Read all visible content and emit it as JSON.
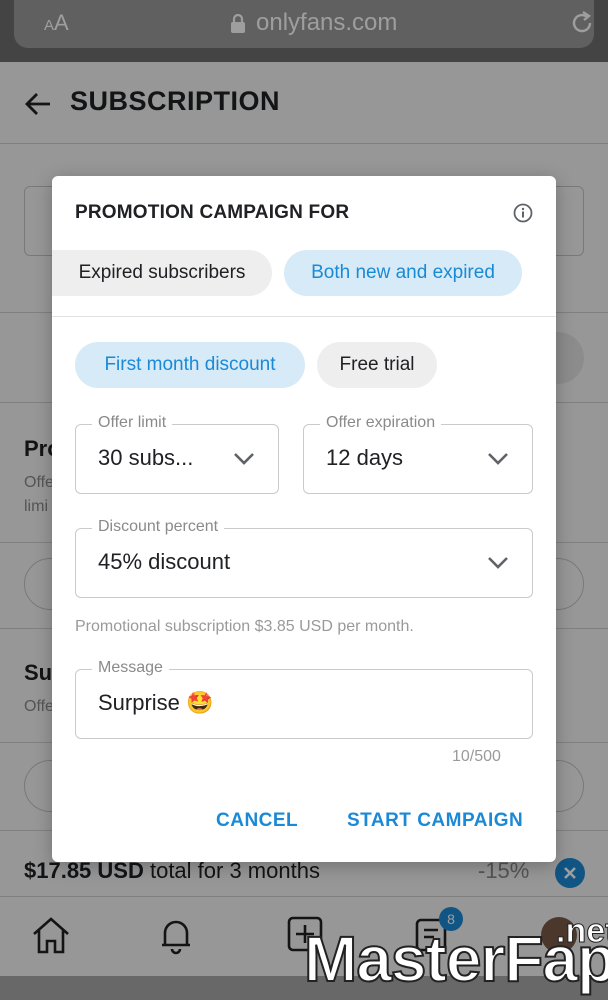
{
  "browser": {
    "aa_small": "A",
    "aa_big": "A",
    "url": "onlyfans.com"
  },
  "page": {
    "title": "SUBSCRIPTION",
    "bg_heading_1": "Pro",
    "bg_sub_1a": "Offe",
    "bg_sub_1b": "limi",
    "bg_heading_2": "Su",
    "bg_sub_2": "Offe",
    "total_amount": "$17.85 USD",
    "total_rest": " total for 3 months",
    "total_discount": "-15%",
    "badge_count": "8"
  },
  "dialog": {
    "title": "PROMOTION CAMPAIGN FOR",
    "audience_options": [
      {
        "label": "Expired subscribers",
        "selected": false
      },
      {
        "label": "Both new and expired",
        "selected": true
      }
    ],
    "type_options": [
      {
        "label": "First month discount",
        "selected": true
      },
      {
        "label": "Free trial",
        "selected": false
      }
    ],
    "offer_limit": {
      "label": "Offer limit",
      "value": "30 subs..."
    },
    "offer_expiration": {
      "label": "Offer expiration",
      "value": "12 days"
    },
    "discount_percent": {
      "label": "Discount percent",
      "value": "45% discount"
    },
    "helper": "Promotional subscription $3.85 USD per month.",
    "message": {
      "label": "Message",
      "value": "Surprise 🤩"
    },
    "counter": "10/500",
    "cancel_label": "CANCEL",
    "start_label": "START CAMPAIGN"
  },
  "watermark": {
    "main": "MasterFap",
    "suffix": ".net"
  },
  "colors": {
    "accent": "#1a8ad6",
    "chip_selected_bg": "#d6eaf7",
    "chip_bg": "#eeeeee"
  }
}
